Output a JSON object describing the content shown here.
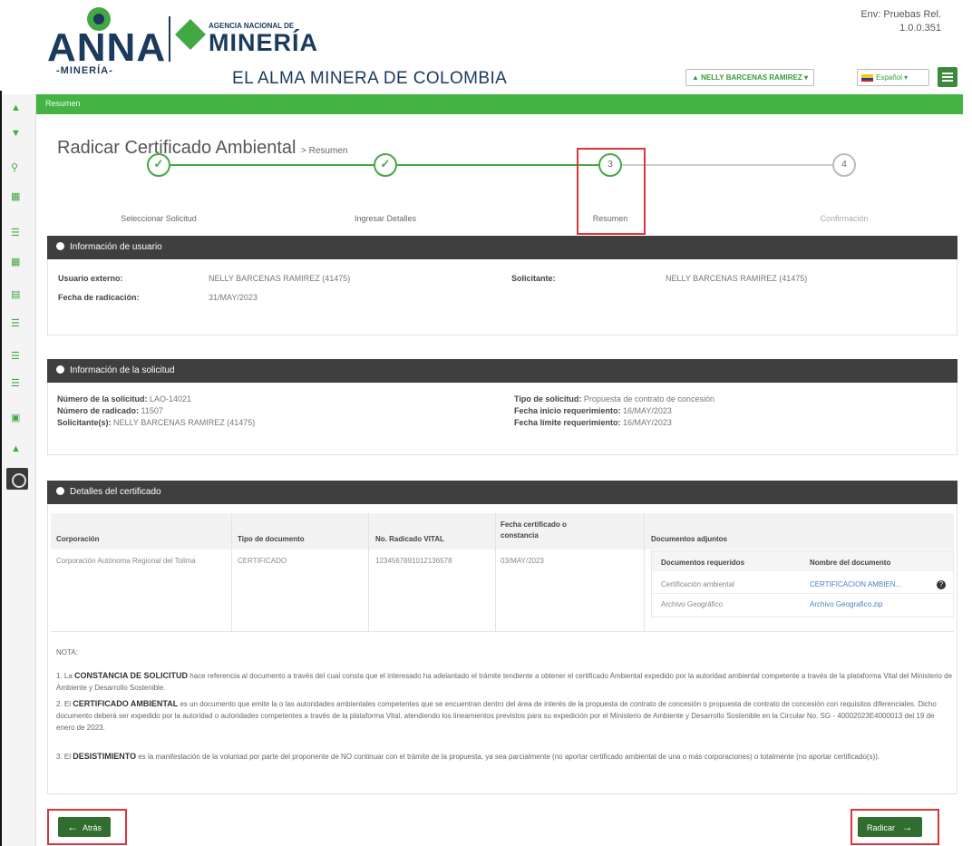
{
  "header": {
    "logo_anna_main": "ANNA",
    "logo_anna_sub": "-MINERÍA-",
    "logo_anm_small": "AGENCIA NACIONAL DE",
    "logo_anm_big": "MINERÍA",
    "tagline": "EL ALMA MINERA DE COLOMBIA",
    "env_label": "Env: Pruebas Rel.",
    "version": "1.0.0.351",
    "user_button": "NELLY BARCENAS RAMIREZ",
    "language_button": "Español"
  },
  "breadcrumb": "Resumen",
  "page": {
    "title": "Radicar Certificado Ambiental",
    "subtitle": "> Resumen"
  },
  "steps": [
    {
      "label": "Seleccionar Solicitud",
      "state": "done",
      "number": ""
    },
    {
      "label": "Ingresar Detalles",
      "state": "done",
      "number": ""
    },
    {
      "label": "Resumen",
      "state": "current",
      "number": "3"
    },
    {
      "label": "Confirmación",
      "state": "pending",
      "number": "4"
    }
  ],
  "user_panel": {
    "title": "Información de usuario",
    "usuario_externo_label": "Usuario externo:",
    "usuario_externo_value": "NELLY BARCENAS RAMIREZ (41475)",
    "fecha_label": "Fecha de radicación:",
    "fecha_value": "31/MAY/2023",
    "solicitante_label": "Solicitante:",
    "solicitante_value": "NELLY BARCENAS RAMIREZ (41475)"
  },
  "request_panel": {
    "title": "Información de la solicitud",
    "numero_solicitud_label": "Número de la solicitud:",
    "numero_solicitud_value": "LAO-14021",
    "numero_radicado_label": "Número de radicado:",
    "numero_radicado_value": "11507",
    "solicitantes_label": "Solicitante(s):",
    "solicitantes_value": "NELLY BARCENAS RAMIREZ (41475)",
    "tipo_label": "Tipo de solicitud:",
    "tipo_value": "Propuesta de contrato de concesión",
    "inicio_label": "Fecha inicio requerimiento:",
    "inicio_value": "16/MAY/2023",
    "limite_label": "Fecha límite requerimiento:",
    "limite_value": "16/MAY/2023"
  },
  "cert_panel": {
    "title": "Detalles del certificado",
    "columns": [
      "Corporación",
      "Tipo de documento",
      "No. Radicado VITAL",
      "Fecha certificado o constancia",
      "Documentos adjuntos"
    ],
    "row": {
      "corporacion": "Corporación Autónoma Regional del Tolima",
      "tipo": "CERTIFICADO",
      "radicado": "1234567891012136578",
      "fecha": "03/MAY/2023"
    },
    "docs_columns": [
      "Documentos requeridos",
      "Nombre del documento"
    ],
    "docs": [
      {
        "requerido": "Certificación ambiental",
        "nombre": "CERTIFICACION AMBIEN..."
      },
      {
        "requerido": "Archivo Geográfico",
        "nombre": "Archivo Geografico.zip"
      }
    ]
  },
  "nota": {
    "title": "NOTA:",
    "item1_prefix": "1. La",
    "item1_bold": "CONSTANCIA DE SOLICITUD",
    "item1_text": "hace referencia al documento a través del cual consta que el interesado ha adelantado el trámite tendiente a obtener el certificado Ambiental expedido por la autoridad ambiental competente a través de la plataforma Vital del Ministerio de Ambiente y Desarrollo Sostenible.",
    "item2_prefix": "2. El",
    "item2_bold": "CERTIFICADO AMBIENTAL",
    "item2_text": "es un documento que emite la o las autoridades ambientales competentes que se encuentran dentro del área de interés de la propuesta de contrato de concesión o propuesta de contrato de concesión con requisitos diferenciales. Dicho documento deberá ser expedido por la autoridad o autoridades competentes a través de la plataforma Vital, atendiendo los lineamientos previstos para su expedición por el Ministerio de Ambiente y Desarrollo Sostenible en la Circular No. SG - 40002023E4000013 del 19 de enero de 2023.",
    "item3_prefix": "3. El",
    "item3_bold": "DESISTIMIENTO",
    "item3_text": "es la manifestación de la voluntad por parte del proponente de NO continuar con el trámite de la propuesta, ya sea parcialmente (no aportar certificado ambiental de una o más corporaciones) o totalmente (no aportar certificado(s))."
  },
  "buttons": {
    "back": "Atrás",
    "submit": "Radicar"
  }
}
